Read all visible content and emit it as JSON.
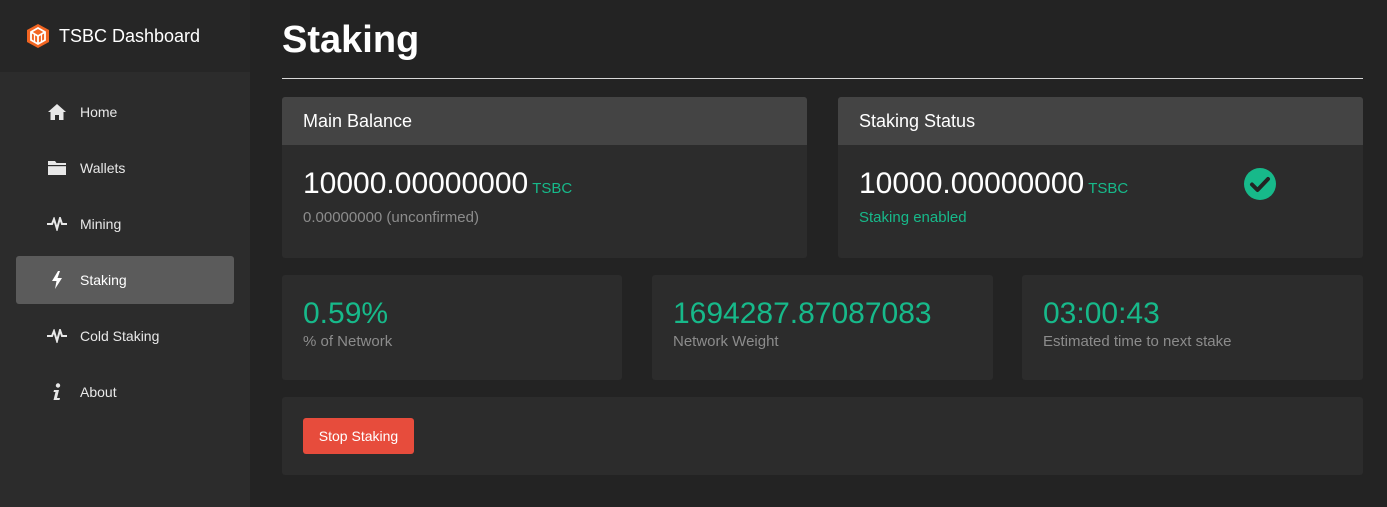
{
  "brand": {
    "title": "TSBC Dashboard",
    "logo_color": "#f26522"
  },
  "sidebar": {
    "items": [
      {
        "label": "Home",
        "icon": "home-icon"
      },
      {
        "label": "Wallets",
        "icon": "folder-icon"
      },
      {
        "label": "Mining",
        "icon": "pulse-icon"
      },
      {
        "label": "Staking",
        "icon": "bolt-icon",
        "active": true
      },
      {
        "label": "Cold Staking",
        "icon": "pulse-icon"
      },
      {
        "label": "About",
        "icon": "info-icon"
      }
    ]
  },
  "page": {
    "title": "Staking"
  },
  "main_balance": {
    "header": "Main Balance",
    "amount": "10000.00000000",
    "unit": "TSBC",
    "unconfirmed": "0.00000000 (unconfirmed)"
  },
  "staking_status": {
    "header": "Staking Status",
    "amount": "10000.00000000",
    "unit": "TSBC",
    "status_text": "Staking enabled",
    "status_icon": "check-circle-icon"
  },
  "stats": [
    {
      "value": "0.59%",
      "label": "% of Network"
    },
    {
      "value": "1694287.87087083",
      "label": "Network Weight"
    },
    {
      "value": "03:00:43",
      "label": "Estimated time to next stake"
    }
  ],
  "actions": {
    "stop_label": "Stop Staking"
  },
  "colors": {
    "accent": "#17b98a",
    "danger": "#e74c3c",
    "active_nav": "#5b5b5b"
  }
}
